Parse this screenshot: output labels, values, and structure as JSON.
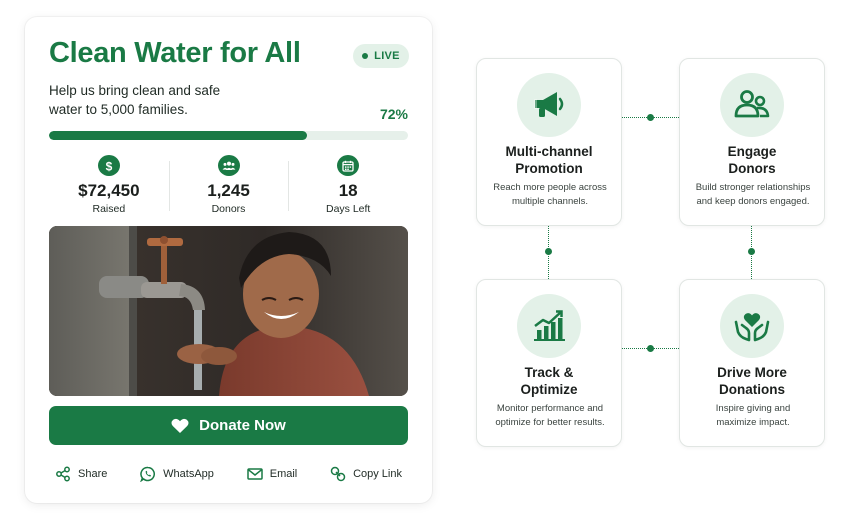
{
  "campaign": {
    "title": "Clean Water for All",
    "status_badge": "LIVE",
    "description": "Help us bring clean and safe water to 5,000 families.",
    "progress_label": "72%",
    "progress_fraction": 0.72,
    "stats": [
      {
        "icon": "dollar-icon",
        "value": "$72,450",
        "label": "Raised"
      },
      {
        "icon": "donors-icon",
        "value": "1,245",
        "label": "Donors"
      },
      {
        "icon": "calendar-icon",
        "value": "18",
        "label": "Days Left"
      }
    ],
    "donate_label": "Donate Now",
    "share": [
      {
        "icon": "share-icon",
        "label": "Share"
      },
      {
        "icon": "whatsapp-icon",
        "label": "WhatsApp"
      },
      {
        "icon": "email-icon",
        "label": "Email"
      },
      {
        "icon": "link-icon",
        "label": "Copy Link"
      }
    ]
  },
  "features": [
    {
      "icon": "megaphone-icon",
      "title_lines": [
        "Multi-channel",
        "Promotion"
      ],
      "desc_lines": [
        "Reach more people across",
        "multiple channels."
      ]
    },
    {
      "icon": "engage-people-icon",
      "title_lines": [
        "Engage",
        "Donors"
      ],
      "desc_lines": [
        "Build stronger relationships",
        "and keep donors engaged."
      ]
    },
    {
      "icon": "growth-chart-icon",
      "title_lines": [
        "Track &",
        "Optimize"
      ],
      "desc_lines": [
        "Monitor performance and",
        "optimize for better results."
      ]
    },
    {
      "icon": "heart-hands-icon",
      "title_lines": [
        "Drive More",
        "Donations"
      ],
      "desc_lines": [
        "Inspire giving and",
        "maximize impact."
      ]
    }
  ],
  "colors": {
    "brand_green": "#1a7a45",
    "light_green": "#e3f1e8",
    "track": "#e6f0ea"
  }
}
